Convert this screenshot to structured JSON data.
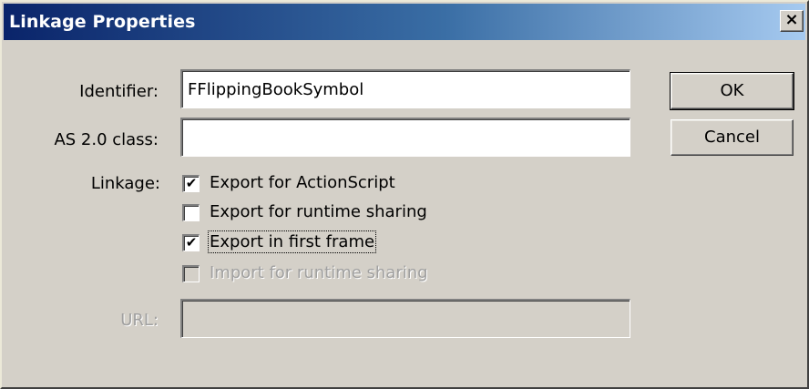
{
  "window": {
    "title": "Linkage Properties",
    "close_glyph": "×"
  },
  "form": {
    "identifier_label": "Identifier:",
    "identifier_value": "FFlippingBookSymbol",
    "class_label": "AS 2.0 class:",
    "class_value": "",
    "linkage_label": "Linkage:",
    "url_label": "URL:",
    "url_value": ""
  },
  "checkboxes": [
    {
      "label": "Export for ActionScript",
      "checked": true,
      "enabled": true
    },
    {
      "label": "Export for runtime sharing",
      "checked": false,
      "enabled": true
    },
    {
      "label": "Export in first frame",
      "checked": true,
      "enabled": true
    },
    {
      "label": "Import for runtime sharing",
      "checked": false,
      "enabled": false
    }
  ],
  "buttons": {
    "ok_label": "OK",
    "cancel_label": "Cancel"
  }
}
